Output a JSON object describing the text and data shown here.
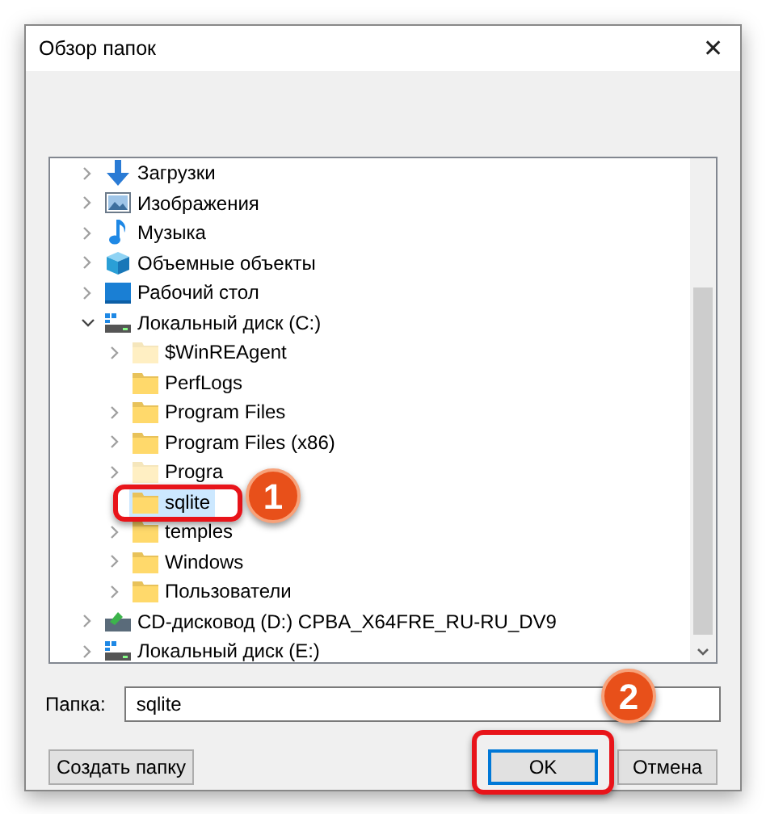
{
  "window": {
    "title": "Обзор папок",
    "close": "✕"
  },
  "tree": [
    {
      "label": "Загрузки",
      "kind": "downloads",
      "expandable": true,
      "expanded": false,
      "selected": false
    },
    {
      "label": "Изображения",
      "kind": "pictures",
      "expandable": true,
      "expanded": false,
      "selected": false
    },
    {
      "label": "Музыка",
      "kind": "music",
      "expandable": true,
      "expanded": false,
      "selected": false
    },
    {
      "label": "Объемные объекты",
      "kind": "objects3d",
      "expandable": true,
      "expanded": false,
      "selected": false
    },
    {
      "label": "Рабочий стол",
      "kind": "desktop",
      "expandable": true,
      "expanded": false,
      "selected": false
    },
    {
      "label": "Локальный диск (C:)",
      "kind": "drive",
      "expandable": true,
      "expanded": true,
      "selected": false,
      "children": [
        {
          "label": "$WinREAgent",
          "kind": "folder",
          "hidden": true,
          "expandable": true,
          "expanded": false,
          "selected": false
        },
        {
          "label": "PerfLogs",
          "kind": "folder",
          "hidden": false,
          "expandable": false,
          "selected": false
        },
        {
          "label": "Program Files",
          "kind": "folder",
          "hidden": false,
          "expandable": true,
          "expanded": false,
          "selected": false
        },
        {
          "label": "Program Files (x86)",
          "kind": "folder",
          "hidden": false,
          "expandable": true,
          "expanded": false,
          "selected": false
        },
        {
          "label": "Progra",
          "kind": "folder",
          "hidden": true,
          "expandable": true,
          "expanded": false,
          "selected": false
        },
        {
          "label": "sqlite",
          "kind": "folder",
          "hidden": false,
          "expandable": false,
          "selected": true
        },
        {
          "label": "temples",
          "kind": "folder",
          "hidden": false,
          "expandable": true,
          "expanded": false,
          "selected": false
        },
        {
          "label": "Windows",
          "kind": "folder",
          "hidden": false,
          "expandable": true,
          "expanded": false,
          "selected": false
        },
        {
          "label": "Пользователи",
          "kind": "folder",
          "hidden": false,
          "expandable": true,
          "expanded": false,
          "selected": false
        }
      ]
    },
    {
      "label": "CD-дисковод (D:) CPBA_X64FRE_RU-RU_DV9",
      "kind": "cd",
      "expandable": true,
      "expanded": false,
      "selected": false
    },
    {
      "label": "Локальный диск (E:)",
      "kind": "drive",
      "expandable": true,
      "expanded": false,
      "selected": false
    }
  ],
  "folder_field": {
    "label": "Папка:",
    "value": "sqlite"
  },
  "buttons": [
    {
      "label": "Создать папку",
      "focused": false
    },
    {
      "label": "OK",
      "focused": true
    },
    {
      "label": "Отмена",
      "focused": false
    }
  ],
  "annotations": [
    {
      "label": "1"
    },
    {
      "label": "2"
    }
  ]
}
